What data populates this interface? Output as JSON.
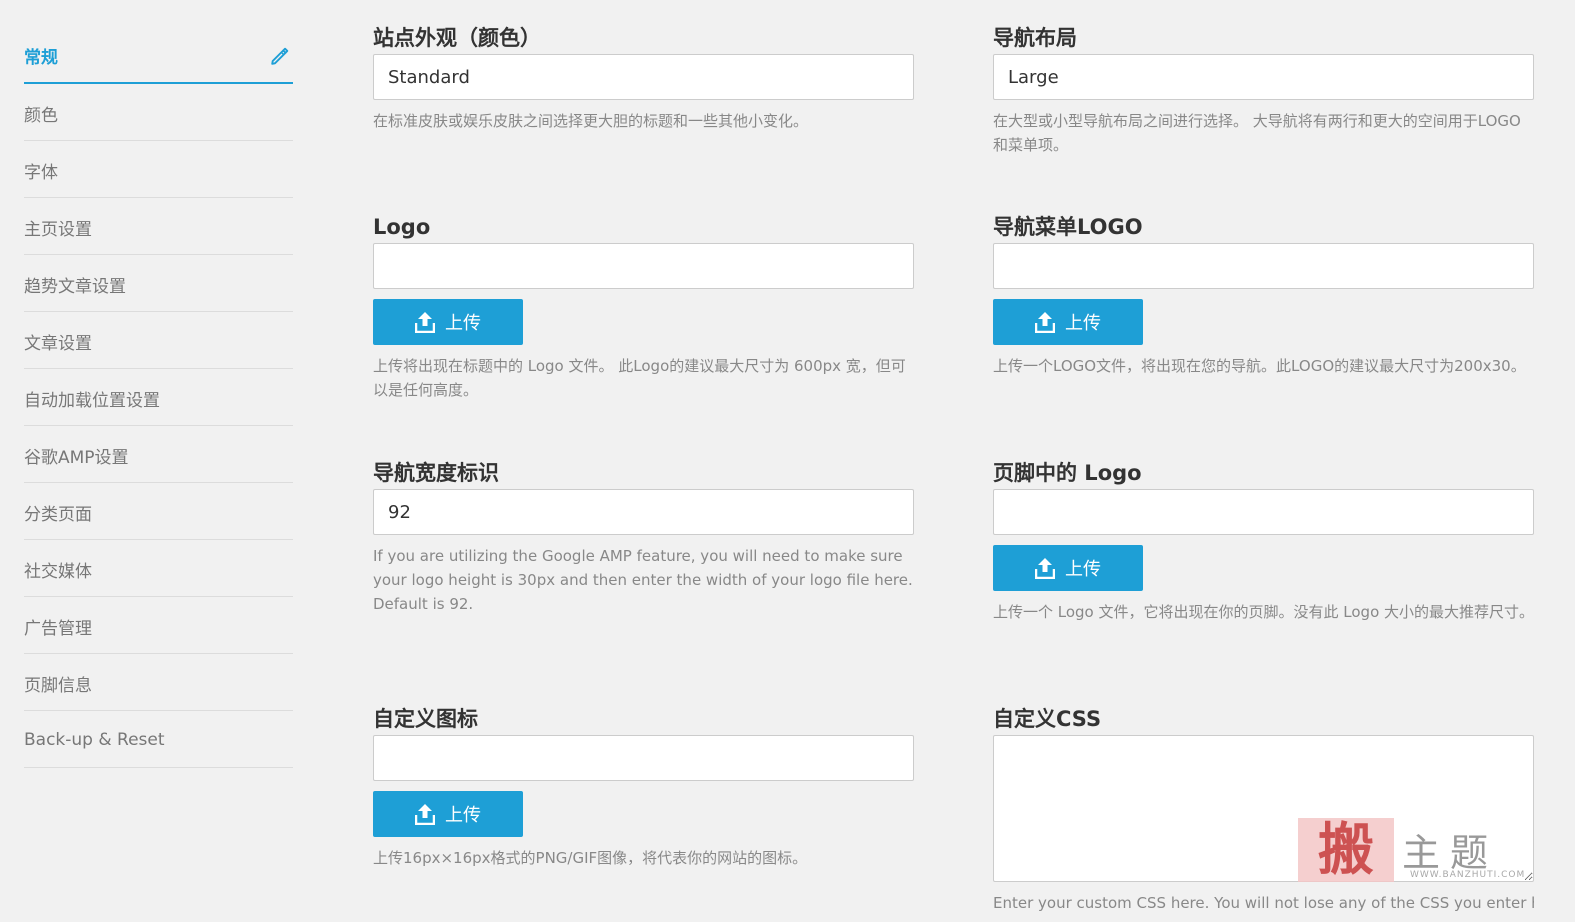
{
  "sidebar": {
    "items": [
      {
        "label": "常规",
        "active": true
      },
      {
        "label": "颜色"
      },
      {
        "label": "字体"
      },
      {
        "label": "主页设置"
      },
      {
        "label": "趋势文章设置"
      },
      {
        "label": "文章设置"
      },
      {
        "label": "自动加载位置设置"
      },
      {
        "label": "谷歌AMP设置"
      },
      {
        "label": "分类页面"
      },
      {
        "label": "社交媒体"
      },
      {
        "label": "广告管理"
      },
      {
        "label": "页脚信息"
      },
      {
        "label": "Back-up & Reset"
      }
    ]
  },
  "fields": {
    "site_skin": {
      "label": "站点外观（颜色）",
      "value": "Standard",
      "help": "在标准皮肤或娱乐皮肤之间选择更大胆的标题和一些其他小变化。"
    },
    "nav_layout": {
      "label": "导航布局",
      "value": "Large",
      "help": "在大型或小型导航布局之间进行选择。 大导航将有两行和更大的空间用于LOGO和菜单项。"
    },
    "logo": {
      "label": "Logo",
      "value": "",
      "button": "上传",
      "help": "上传将出现在标题中的 Logo 文件。 此Logo的建议最大尺寸为 600px 宽，但可以是任何高度。"
    },
    "nav_menu_logo": {
      "label": "导航菜单LOGO",
      "value": "",
      "button": "上传",
      "help": "上传一个LOGO文件，将出现在您的导航。此LOGO的建议最大尺寸为200x30。"
    },
    "nav_width": {
      "label": "导航宽度标识",
      "value": "92",
      "help": "If you are utilizing the Google AMP feature, you will need to make sure your logo height is 30px and then enter the width of your logo file here. Default is 92."
    },
    "footer_logo": {
      "label": "页脚中的 Logo",
      "value": "",
      "button": "上传",
      "help": "上传一个 Logo 文件，它将出现在你的页脚。没有此 Logo 大小的最大推荐尺寸。"
    },
    "custom_icon": {
      "label": "自定义图标",
      "value": "",
      "button": "上传",
      "help": "上传16px×16px格式的PNG/GIF图像，将代表你的网站的图标。"
    },
    "custom_css": {
      "label": "自定义CSS",
      "value": "",
      "help": "Enter your custom CSS here. You will not lose any of the CSS you enter here"
    }
  },
  "watermark": {
    "seal": "搬",
    "text": "主题",
    "url": "WWW.BANZHUTI.COM"
  },
  "colors": {
    "accent": "#1e9fd6",
    "background": "#f1f1f1",
    "help_text": "#888888"
  },
  "icons": {
    "edit": "pencil-icon",
    "upload": "upload-icon"
  }
}
